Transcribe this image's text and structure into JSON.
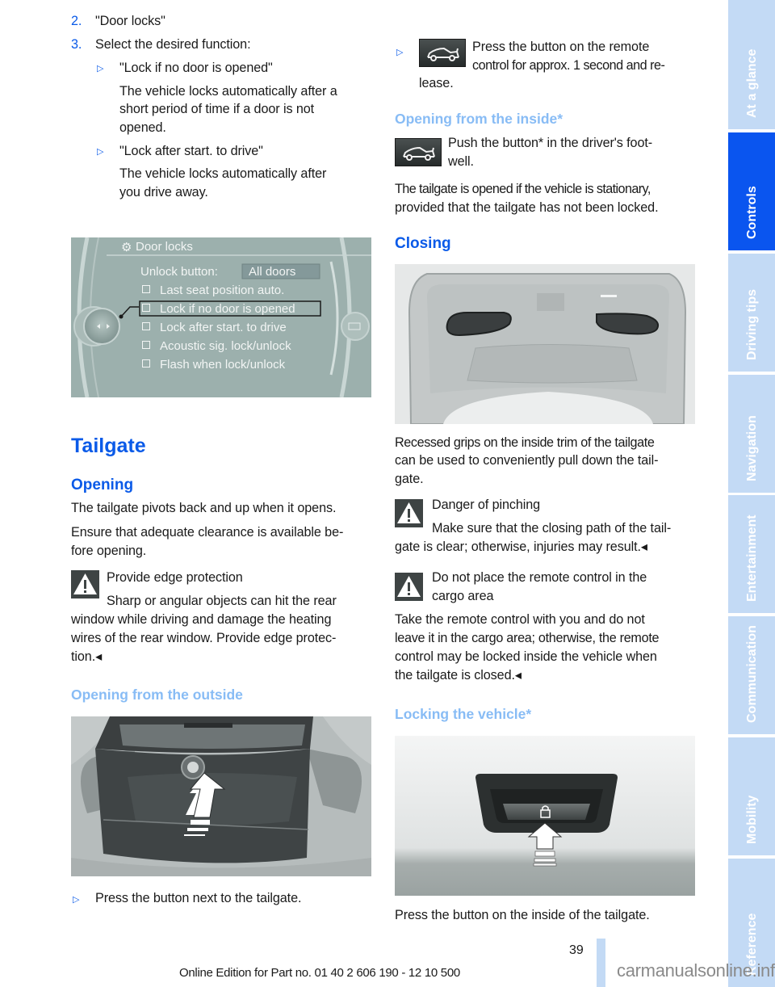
{
  "left_column": {
    "steps": [
      {
        "number": "2.",
        "text": "\"Door locks\""
      },
      {
        "number": "3.",
        "text": "Select the desired function:"
      }
    ],
    "options": [
      {
        "title": "\"Lock if no door is opened\"",
        "desc_lines": [
          "The vehicle locks automatically after a",
          "short period of time if a door is not",
          "opened."
        ]
      },
      {
        "title": "\"Lock after start. to drive\"",
        "desc_lines": [
          "The vehicle locks automatically after",
          "you drive away."
        ]
      }
    ],
    "idrive_screen": {
      "header": "Door locks",
      "unlock_label": "Unlock button:",
      "unlock_value": "All doors",
      "items": [
        "Last seat position auto.",
        "Lock if no door is opened",
        "Lock after start. to drive",
        "Acoustic sig. lock/unlock",
        "Flash when lock/unlock"
      ],
      "selected_index": 1
    },
    "section_title": "Tailgate",
    "opening_title": "Opening",
    "opening_p1": "The tailgate pivots back and up when it opens.",
    "opening_p2_lines": [
      "Ensure that adequate clearance is available be-",
      "fore opening."
    ],
    "warning1": {
      "title": "Provide edge protection",
      "lines": [
        "Sharp or angular objects can hit the rear",
        "window while driving and damage the heating",
        "wires of the rear window. Provide edge protec-",
        "tion.◂"
      ]
    },
    "outside_title": "Opening from the outside",
    "outside_bullet": "Press the button next to the tailgate."
  },
  "right_column": {
    "remote_bullet_lines": [
      "Press the button on the remote",
      "control for approx. 1 second and re-",
      "lease."
    ],
    "inside_title": "Opening from the inside*",
    "inside_text_lines": [
      "Push the button* in the driver's foot-",
      "well."
    ],
    "inside_p_lines": [
      "The tailgate is opened if the vehicle is stationary,",
      "provided that the tailgate has not been locked."
    ],
    "closing_title": "Closing",
    "closing_p_lines": [
      "Recessed grips on the inside trim of the tailgate",
      "can be used to conveniently pull down the tail-",
      "gate."
    ],
    "warning2": {
      "title": "Danger of pinching",
      "lines": [
        "Make sure that the closing path of the tail-",
        "gate is clear; otherwise, injuries may result.◂"
      ]
    },
    "warning3": {
      "title_lines": [
        "Do not place the remote control in the",
        "cargo area"
      ],
      "lines": [
        "Take the remote control with you and do not",
        "leave it in the cargo area; otherwise, the remote",
        "control may be locked inside the vehicle when",
        "the tailgate is closed.◂"
      ]
    },
    "locking_title": "Locking the vehicle*",
    "locking_p": "Press the button on the inside of the tailgate."
  },
  "side_tabs": [
    {
      "label": "At a glance",
      "active": false
    },
    {
      "label": "Controls",
      "active": true
    },
    {
      "label": "Driving tips",
      "active": false
    },
    {
      "label": "Navigation",
      "active": false
    },
    {
      "label": "Entertainment",
      "active": false
    },
    {
      "label": "Communication",
      "active": false
    },
    {
      "label": "Mobility",
      "active": false
    },
    {
      "label": "Reference",
      "active": false
    }
  ],
  "footer": {
    "page_number": "39",
    "edition": "Online Edition for Part no. 01 40 2 606 190 - 12 10 500",
    "watermark": "carmanualsonline.info"
  },
  "icons": {
    "bullet": "▷",
    "warning": "warning-triangle-icon",
    "tailgate_button": "car-tailgate-icon"
  },
  "colors": {
    "accent": "#0a5ae8",
    "subheading": "#88bcf5",
    "tab_inactive": "#c3daf5",
    "tab_active": "#0a55ef"
  }
}
